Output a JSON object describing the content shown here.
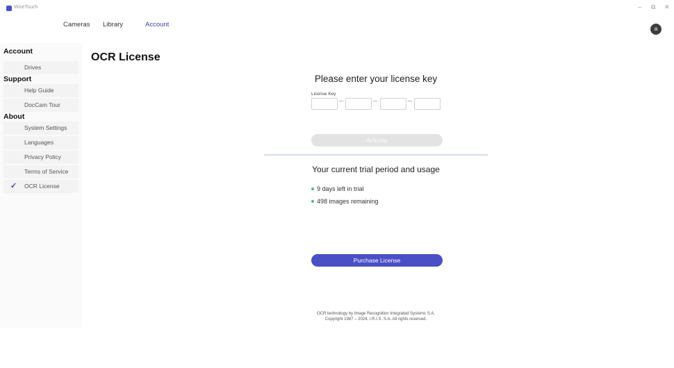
{
  "window": {
    "title": "WiseTouch",
    "minimize": "–",
    "restore": "⧉",
    "close": "✕"
  },
  "topnav": {
    "tabs": [
      {
        "label": "Cameras"
      },
      {
        "label": "Library"
      },
      {
        "label": "Account",
        "active": true
      }
    ],
    "avatar_initial": "a"
  },
  "sidebar": {
    "sections": [
      {
        "heading": "Account",
        "items": [
          {
            "label": "Drives"
          }
        ]
      },
      {
        "heading": "Support",
        "items": [
          {
            "label": "Help Guide"
          },
          {
            "label": "DocCam Tour"
          }
        ]
      },
      {
        "heading": "About",
        "items": [
          {
            "label": "System Settings"
          },
          {
            "label": "Languages"
          },
          {
            "label": "Privacy Policy"
          },
          {
            "label": "Terms of Service"
          },
          {
            "label": "OCR License",
            "selected": true
          }
        ]
      }
    ],
    "selected_mark": "✓"
  },
  "main": {
    "page_title": "OCR License",
    "license": {
      "heading": "Please enter your license key",
      "field_label": "License Key",
      "activate_label": "Activate"
    },
    "trial": {
      "heading": "Your current trial period and usage",
      "items": [
        "9 days left in trial",
        "498 images remaining"
      ]
    },
    "purchase_label": "Purchase License",
    "footer": {
      "line1": "OCR technology by Image Recognition Integrated Systems S.A.",
      "line2": "Copyright 1987 – 2024, I.R.I.S. S.A. All rights reserved."
    }
  },
  "colors": {
    "accent": "#4a4fc6",
    "status_dot": "#4db88c",
    "disabled_button": "#e3e3e3"
  }
}
